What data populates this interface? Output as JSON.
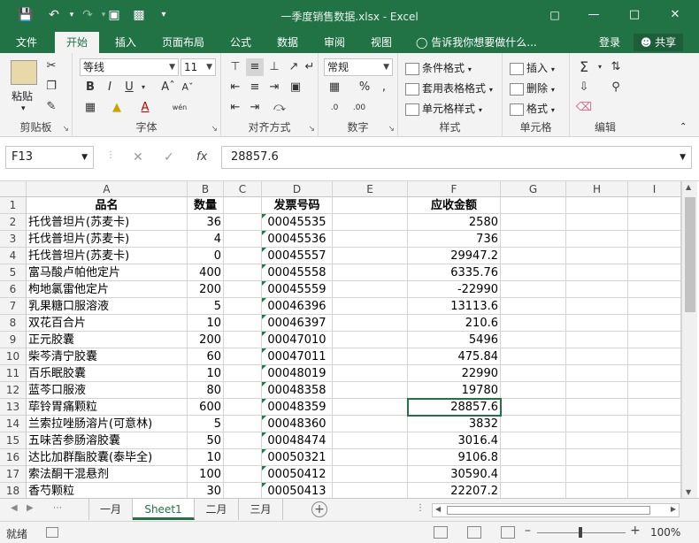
{
  "window": {
    "title": "一季度销售数据.xlsx - Excel"
  },
  "ribbon_tabs": [
    "文件",
    "开始",
    "插入",
    "页面布局",
    "公式",
    "数据",
    "审阅",
    "视图"
  ],
  "active_tab": "开始",
  "tell_me": "告诉我你想要做什么...",
  "account": {
    "login": "登录",
    "share": "共享"
  },
  "ribbon": {
    "clipboard": {
      "paste": "粘贴",
      "label": "剪贴板"
    },
    "font": {
      "name": "等线",
      "size": "11",
      "label": "字体",
      "wen": "wén",
      "bold": "B",
      "italic": "I",
      "underline": "U"
    },
    "alignment": {
      "label": "对齐方式"
    },
    "number": {
      "format": "常规",
      "label": "数字"
    },
    "styles": {
      "conditional": "条件格式",
      "table": "套用表格格式",
      "cell_styles": "单元格样式",
      "label": "样式"
    },
    "cells": {
      "insert": "插入",
      "delete": "删除",
      "format": "格式",
      "label": "单元格"
    },
    "editing": {
      "label": "编辑"
    }
  },
  "formula_bar": {
    "name_box": "F13",
    "value": "28857.6",
    "fx": "fx"
  },
  "columns": [
    "A",
    "B",
    "C",
    "D",
    "E",
    "F",
    "G",
    "H",
    "I"
  ],
  "header_row": {
    "row": "1",
    "a": "品名",
    "b": "数量",
    "d": "发票号码",
    "f": "应收金额"
  },
  "rows": [
    {
      "row": "2",
      "a": "托伐普坦片(苏麦卡)",
      "b": "36",
      "d": "00045535",
      "f": "2580"
    },
    {
      "row": "3",
      "a": "托伐普坦片(苏麦卡)",
      "b": "4",
      "d": "00045536",
      "f": "736"
    },
    {
      "row": "4",
      "a": "托伐普坦片(苏麦卡)",
      "b": "0",
      "d": "00045557",
      "f": "29947.2"
    },
    {
      "row": "5",
      "a": "富马酸卢帕他定片",
      "b": "400",
      "d": "00045558",
      "f": "6335.76"
    },
    {
      "row": "6",
      "a": "枸地氯雷他定片",
      "b": "200",
      "d": "00045559",
      "f": "-22990"
    },
    {
      "row": "7",
      "a": "乳果糖口服溶液",
      "b": "5",
      "d": "00046396",
      "f": "13113.6"
    },
    {
      "row": "8",
      "a": "双花百合片",
      "b": "10",
      "d": "00046397",
      "f": "210.6"
    },
    {
      "row": "9",
      "a": "正元胶囊",
      "b": "200",
      "d": "00047010",
      "f": "5496"
    },
    {
      "row": "10",
      "a": "柴芩清宁胶囊",
      "b": "60",
      "d": "00047011",
      "f": "475.84"
    },
    {
      "row": "11",
      "a": "百乐眠胶囊",
      "b": "10",
      "d": "00048019",
      "f": "22990"
    },
    {
      "row": "12",
      "a": "蓝芩口服液",
      "b": "80",
      "d": "00048358",
      "f": "19780"
    },
    {
      "row": "13",
      "a": "荜铃胃痛颗粒",
      "b": "600",
      "d": "00048359",
      "f": "28857.6"
    },
    {
      "row": "14",
      "a": "兰索拉唑肠溶片(可意林)",
      "b": "5",
      "d": "00048360",
      "f": "3832"
    },
    {
      "row": "15",
      "a": "五味苦参肠溶胶囊",
      "b": "50",
      "d": "00048474",
      "f": "3016.4"
    },
    {
      "row": "16",
      "a": "达比加群酯胶囊(泰毕全)",
      "b": "10",
      "d": "00050321",
      "f": "9106.8"
    },
    {
      "row": "17",
      "a": "索法酮干混悬剂",
      "b": "100",
      "d": "00050412",
      "f": "30590.4"
    },
    {
      "row": "18",
      "a": "香芍颗粒",
      "b": "30",
      "d": "00050413",
      "f": "22207.2"
    }
  ],
  "sheets": [
    "一月",
    "Sheet1",
    "二月",
    "三月"
  ],
  "active_sheet": "Sheet1",
  "status": {
    "ready": "就绪",
    "zoom": "100%"
  },
  "colors": {
    "accent": "#217346"
  }
}
